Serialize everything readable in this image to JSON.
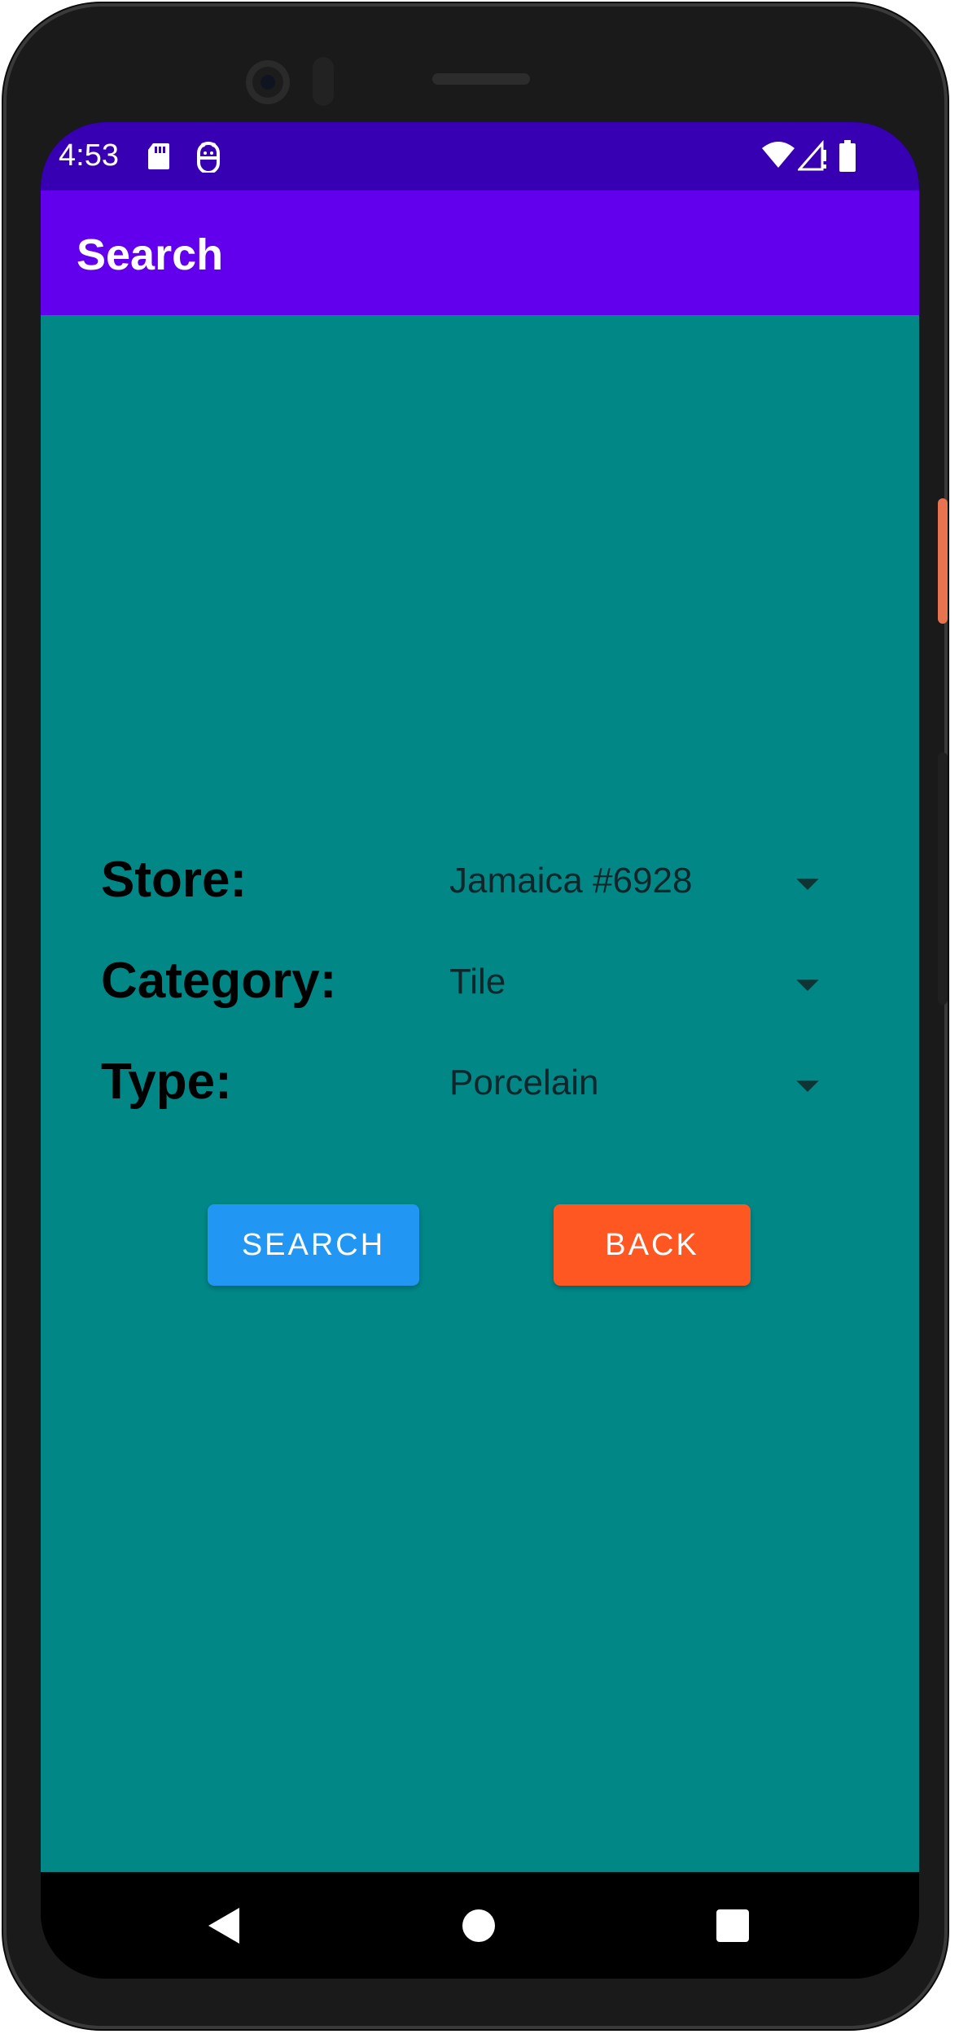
{
  "status_bar": {
    "time": "4:53",
    "icons": [
      "sd-card-icon",
      "android-debug-icon",
      "wifi-icon",
      "cell-signal-icon",
      "battery-icon"
    ],
    "color": "#3700b3"
  },
  "app_bar": {
    "title": "Search",
    "color": "#6200ee"
  },
  "form": {
    "background": "#028787",
    "rows": [
      {
        "label": "Store:",
        "value": "Jamaica #6928"
      },
      {
        "label": "Category:",
        "value": "Tile"
      },
      {
        "label": "Type:",
        "value": "Porcelain"
      }
    ]
  },
  "buttons": {
    "search_label": "SEARCH",
    "search_color": "#2196f3",
    "back_label": "BACK",
    "back_color": "#ff5722"
  },
  "nav_bar": {
    "icons": [
      "nav-back-icon",
      "nav-home-icon",
      "nav-recents-icon"
    ]
  }
}
